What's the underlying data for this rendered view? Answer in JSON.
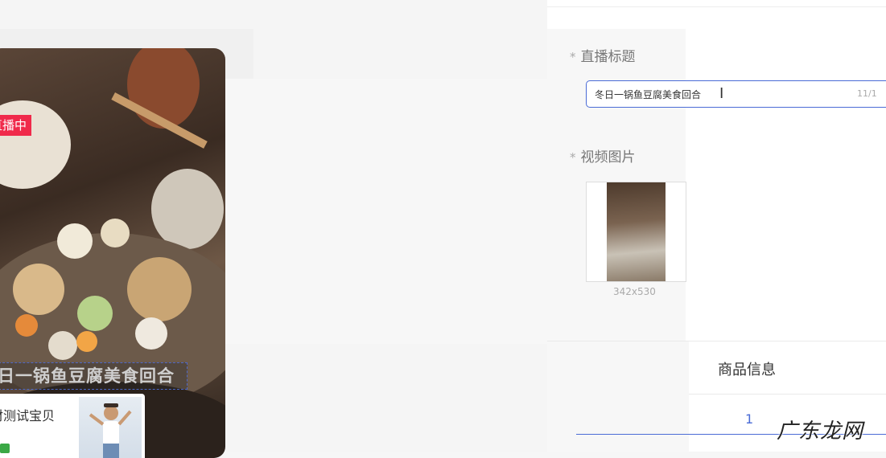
{
  "preview": {
    "live_badge": "直播中",
    "title_overlay": "冬日一锅鱼豆腐美食回合",
    "product": {
      "title": "材测试宝贝",
      "subtitle": ")"
    }
  },
  "form": {
    "title_label": "直播标题",
    "title_value": "冬日一锅鱼豆腐美食回合",
    "title_count": "11/1",
    "image_label": "视频图片",
    "image_size": "342x530",
    "required_mark": "*"
  },
  "tabs": {
    "product_info": "商品信息"
  },
  "pagination": {
    "current": "1"
  },
  "watermark": "广东龙网",
  "colors": {
    "accent": "#4a6bd6",
    "live_badge": "#f02a4b"
  }
}
